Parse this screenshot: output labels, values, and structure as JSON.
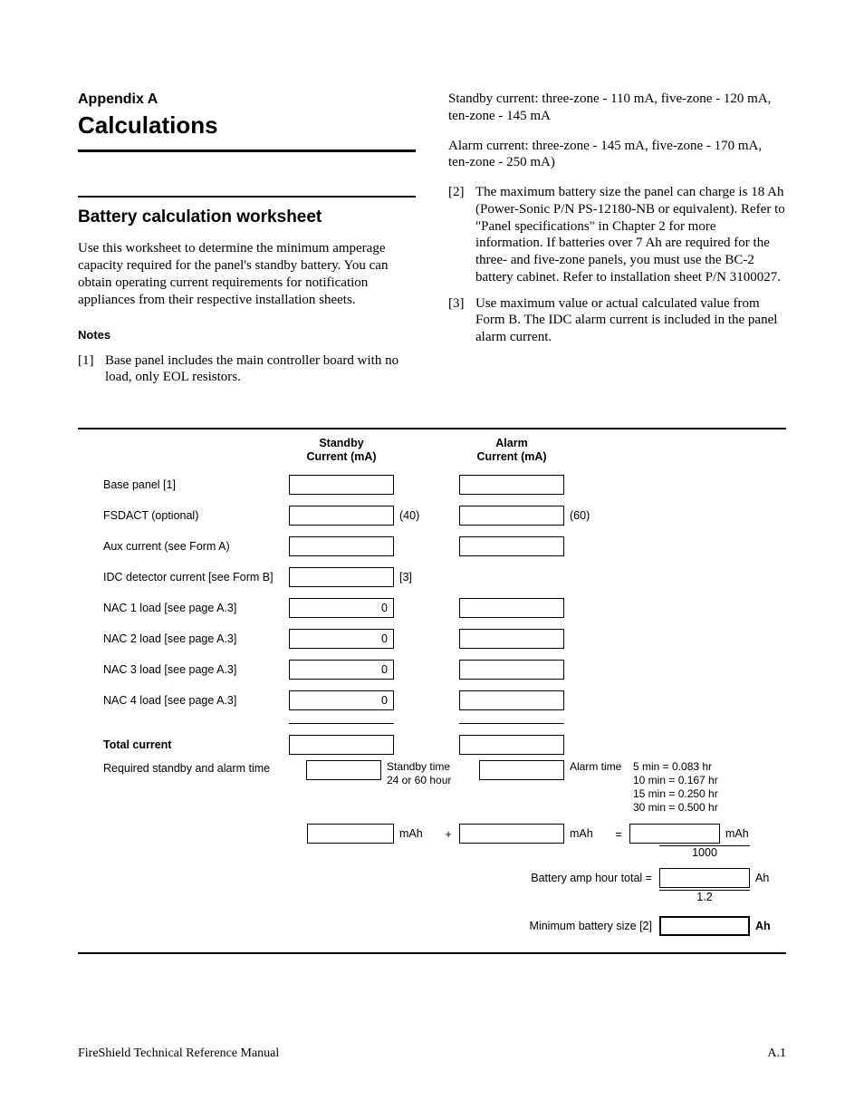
{
  "header": {
    "appendix_label": "Appendix A",
    "appendix_title": "Calculations",
    "section_title": "Battery calculation worksheet",
    "intro_para": "Use this worksheet to determine the minimum amperage capacity required for the panel's standby battery. You can obtain operating current requirements for notification appliances from their respective installation sheets.",
    "notes_head": "Notes"
  },
  "notes_left": [
    {
      "num": "[1]",
      "text": "Base panel includes the main controller board with no load, only EOL resistors."
    }
  ],
  "notes_right_pre": [
    "Standby current: three-zone - 110 mA, five-zone - 120 mA, ten-zone - 145 mA",
    "Alarm current: three-zone - 145 mA, five-zone - 170 mA, ten-zone - 250 mA)"
  ],
  "notes_right": [
    {
      "num": "[2]",
      "text": "The maximum battery size the panel can charge is 18 Ah (Power-Sonic P/N PS-12180-NB or equivalent). Refer to \"Panel specifications\" in Chapter 2 for more information. If batteries over 7 Ah are required for the three- and five-zone panels, you must use the BC-2 battery cabinet. Refer to installation sheet P/N 3100027."
    },
    {
      "num": "[3]",
      "text": "Use maximum value or actual calculated value from Form B. The IDC alarm current is included in the panel alarm current."
    }
  ],
  "worksheet": {
    "col_headers": {
      "standby": "Standby\nCurrent (mA)",
      "alarm": "Alarm\nCurrent (mA)"
    },
    "rows": [
      {
        "label": "Base panel [1]",
        "standby_val": "",
        "standby_after": "",
        "alarm_val": "",
        "alarm_after": ""
      },
      {
        "label": "FSDACT (optional)",
        "standby_val": "",
        "standby_after": "(40)",
        "alarm_val": "",
        "alarm_after": "(60)"
      },
      {
        "label": "Aux current (see Form A)",
        "standby_val": "",
        "standby_after": "",
        "alarm_val": "",
        "alarm_after": ""
      },
      {
        "label": "IDC detector current [see Form B]",
        "standby_val": "",
        "standby_after": "[3]",
        "alarm_val": null,
        "alarm_after": ""
      },
      {
        "label": "NAC 1 load [see page A.3]",
        "standby_val": "0",
        "standby_after": "",
        "alarm_val": "",
        "alarm_after": ""
      },
      {
        "label": "NAC 2 load [see page A.3]",
        "standby_val": "0",
        "standby_after": "",
        "alarm_val": "",
        "alarm_after": ""
      },
      {
        "label": "NAC 3 load [see page A.3]",
        "standby_val": "0",
        "standby_after": "",
        "alarm_val": "",
        "alarm_after": ""
      },
      {
        "label": "NAC 4 load [see page A.3]",
        "standby_val": "0",
        "standby_after": "",
        "alarm_val": "",
        "alarm_after": ""
      }
    ],
    "total_label": "Total current",
    "req_time_label": "Required standby and alarm time",
    "standby_time_hint": "Standby time 24 or 60 hour",
    "alarm_time_hint": "Alarm time",
    "time_conversions": "5 min = 0.083 hr\n10 min = 0.167 hr\n15 min = 0.250 hr\n30 min = 0.500 hr",
    "mAh_unit": "mAh",
    "plus": "+",
    "equals": "=",
    "divisor1": "1000",
    "bat_total_label": "Battery amp hour total =",
    "ah_unit": "Ah",
    "multiplier": "1.2",
    "min_bat_label": "Minimum battery size [2]",
    "ah_bold": "Ah"
  },
  "footer": {
    "left": "FireShield Technical Reference Manual",
    "right": "A.1"
  }
}
